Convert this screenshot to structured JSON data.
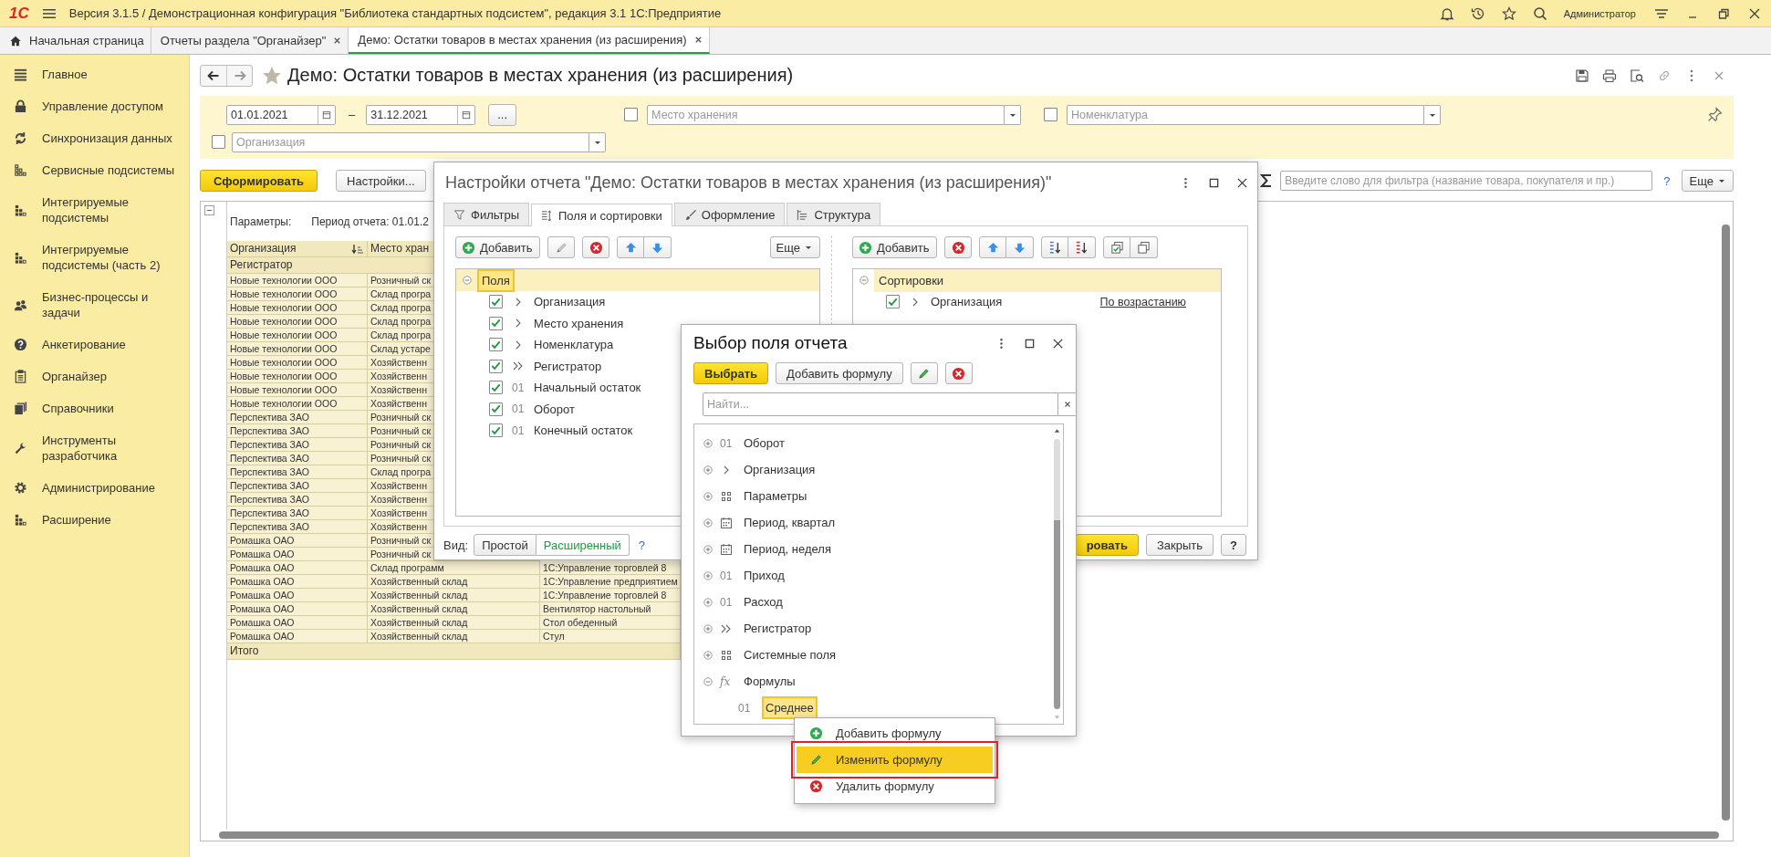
{
  "app": {
    "logo": "1С",
    "title": "Версия 3.1.5 / Демонстрационная конфигурация \"Библиотека стандартных подсистем\", редакция 3.1 1С:Предприятие",
    "user": "Администратор"
  },
  "open_tabs": [
    {
      "label": "Начальная страница",
      "kind": "home",
      "selected": false
    },
    {
      "label": "Отчеты раздела \"Органайзер\"",
      "kind": "closable",
      "selected": false
    },
    {
      "label": "Демо: Остатки товаров в местах хранения (из расширения)",
      "kind": "closable",
      "selected": true
    }
  ],
  "sidebar": {
    "items": [
      {
        "label": "Главное"
      },
      {
        "label": "Управление доступом"
      },
      {
        "label": "Синхронизация данных"
      },
      {
        "label": "Сервисные подсистемы"
      },
      {
        "label": "Интегрируемые подсистемы"
      },
      {
        "label": "Интегрируемые подсистемы (часть 2)"
      },
      {
        "label": "Бизнес-процессы и задачи"
      },
      {
        "label": "Анкетирование"
      },
      {
        "label": "Органайзер"
      },
      {
        "label": "Справочники"
      },
      {
        "label": "Инструменты разработчика"
      },
      {
        "label": "Администрирование"
      },
      {
        "label": "Расширение"
      }
    ]
  },
  "report": {
    "title": "Демо: Остатки товаров в местах хранения (из расширения)",
    "date_from": "01.01.2021",
    "date_separator": "–",
    "date_to": "31.12.2021",
    "period_button": "...",
    "storage": {
      "placeholder": "Место хранения",
      "checked": false
    },
    "nomenclature": {
      "placeholder": "Номенклатура",
      "checked": false
    },
    "organization": {
      "placeholder": "Организация",
      "checked": false
    },
    "generate": "Сформировать",
    "settings": "Настройки...",
    "search_placeholder": "Введите слово для фильтра (название товара, покупателя и пр.)",
    "help": "?",
    "more": "Еще",
    "params_label": "Параметры:",
    "period": "Период отчета: 01.01.2",
    "columns": [
      "Организация",
      "Место хран"
    ],
    "group_header": "Регистратор",
    "rows": [
      {
        "organization": "Новые технологии ООО",
        "storage": "Розничный ск"
      },
      {
        "organization": "Новые технологии ООО",
        "storage": "Склад програ"
      },
      {
        "organization": "Новые технологии ООО",
        "storage": "Склад програ"
      },
      {
        "organization": "Новые технологии ООО",
        "storage": "Склад програ"
      },
      {
        "organization": "Новые технологии ООО",
        "storage": "Склад програ"
      },
      {
        "organization": "Новые технологии ООО",
        "storage": "Склад устаре"
      },
      {
        "organization": "Новые технологии ООО",
        "storage": "Хозяйственн"
      },
      {
        "organization": "Новые технологии ООО",
        "storage": "Хозяйственн"
      },
      {
        "organization": "Новые технологии ООО",
        "storage": "Хозяйственн"
      },
      {
        "organization": "Новые технологии ООО",
        "storage": "Хозяйственн"
      },
      {
        "organization": "Перспектива ЗАО",
        "storage": "Розничный ск"
      },
      {
        "organization": "Перспектива ЗАО",
        "storage": "Розничный ск"
      },
      {
        "organization": "Перспектива ЗАО",
        "storage": "Розничный ск"
      },
      {
        "organization": "Перспектива ЗАО",
        "storage": "Розничный ск"
      },
      {
        "organization": "Перспектива ЗАО",
        "storage": "Склад програ"
      },
      {
        "organization": "Перспектива ЗАО",
        "storage": "Хозяйственн"
      },
      {
        "organization": "Перспектива ЗАО",
        "storage": "Хозяйственн"
      },
      {
        "organization": "Перспектива ЗАО",
        "storage": "Хозяйственн"
      },
      {
        "organization": "Перспектива ЗАО",
        "storage": "Хозяйственн"
      },
      {
        "organization": "Ромашка ОАО",
        "storage": "Розничный ск"
      },
      {
        "organization": "Ромашка ОАО",
        "storage": "Розничный ск"
      },
      {
        "organization": "Ромашка ОАО",
        "storage": "Склад программ",
        "product": "1С:Управление торговлей 8"
      },
      {
        "organization": "Ромашка ОАО",
        "storage": "Хозяйственный склад",
        "product": "1С:Управление предприятием"
      },
      {
        "organization": "Ромашка ОАО",
        "storage": "Хозяйственный склад",
        "product": "1С:Управление торговлей 8"
      },
      {
        "organization": "Ромашка ОАО",
        "storage": "Хозяйственный склад",
        "product": "Вентилятор настольный"
      },
      {
        "organization": "Ромашка ОАО",
        "storage": "Хозяйственный склад",
        "product": "Стол обеденный"
      },
      {
        "organization": "Ромашка ОАО",
        "storage": "Хозяйственный склад",
        "product": "Стул"
      }
    ],
    "total": "Итого"
  },
  "settings_dialog": {
    "title": "Настройки отчета \"Демо: Остатки товаров в местах хранения (из расширения)\"",
    "tabs": [
      {
        "label": "Фильтры",
        "selected": false
      },
      {
        "label": "Поля и сортировки",
        "selected": true
      },
      {
        "label": "Оформление",
        "selected": false
      },
      {
        "label": "Структура",
        "selected": false
      }
    ],
    "add": "Добавить",
    "more": "Еще",
    "fields_root": {
      "label": "Поля",
      "expanded": true,
      "selected": true
    },
    "fields": [
      {
        "label": "Организация",
        "checked": true,
        "kind": "dimension"
      },
      {
        "label": "Место хранения",
        "checked": true,
        "kind": "dimension"
      },
      {
        "label": "Номенклатура",
        "checked": true,
        "kind": "dimension"
      },
      {
        "label": "Регистратор",
        "checked": true,
        "kind": "registrar"
      },
      {
        "label": "Начальный остаток",
        "checked": true,
        "kind": "resource",
        "prefix": "01"
      },
      {
        "label": "Оборот",
        "checked": true,
        "kind": "resource",
        "prefix": "01"
      },
      {
        "label": "Конечный остаток",
        "checked": true,
        "kind": "resource",
        "prefix": "01"
      }
    ],
    "sort_add": "Добавить",
    "sort_root": {
      "label": "Сортировки",
      "expanded": true
    },
    "sorts": [
      {
        "label": "Организация",
        "checked": true,
        "kind": "dimension",
        "order": "По возрастанию"
      }
    ],
    "view_label": "Вид:",
    "view_options": [
      {
        "label": "Простой",
        "selected": false
      },
      {
        "label": "Расширенный",
        "selected": true
      }
    ],
    "view_help": "?",
    "finish": "ровать",
    "close": "Закрыть",
    "help": "?"
  },
  "field_dialog": {
    "title": "Выбор поля отчета",
    "select": "Выбрать",
    "add_formula": "Добавить формулу",
    "search_placeholder": "Найти...",
    "items": [
      {
        "label": "Оборот",
        "kind": "resource",
        "prefix": "01",
        "expanded": false
      },
      {
        "label": "Организация",
        "kind": "dimension",
        "expanded": false
      },
      {
        "label": "Параметры",
        "kind": "group",
        "expanded": false
      },
      {
        "label": "Период, квартал",
        "kind": "period",
        "expanded": false
      },
      {
        "label": "Период, неделя",
        "kind": "period",
        "expanded": false
      },
      {
        "label": "Приход",
        "kind": "resource",
        "prefix": "01",
        "expanded": false
      },
      {
        "label": "Расход",
        "kind": "resource",
        "prefix": "01",
        "expanded": false
      },
      {
        "label": "Регистратор",
        "kind": "registrar",
        "expanded": false
      },
      {
        "label": "Системные поля",
        "kind": "group",
        "expanded": false
      },
      {
        "label": "Формулы",
        "kind": "formula",
        "prefix": "fx",
        "expanded": true,
        "children": [
          {
            "label": "Среднее",
            "kind": "resource",
            "prefix": "01",
            "selected": true
          }
        ]
      }
    ]
  },
  "context_menu": {
    "items": [
      {
        "label": "Добавить формулу",
        "kind": "add",
        "selected": false,
        "annotated": false
      },
      {
        "label": "Изменить формулу",
        "kind": "edit",
        "selected": true,
        "annotated": true
      },
      {
        "label": "Удалить формулу",
        "kind": "delete",
        "selected": false,
        "annotated": false
      }
    ]
  }
}
